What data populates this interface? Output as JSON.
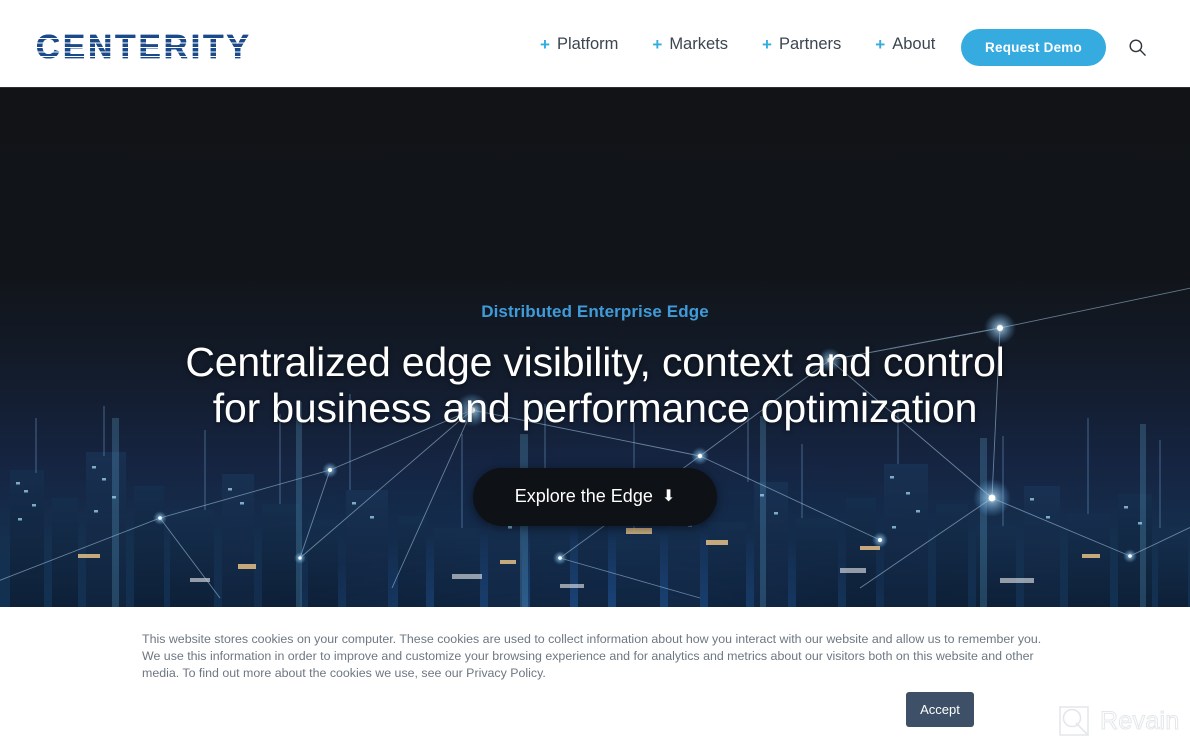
{
  "header": {
    "logo_text": "CENTERITY",
    "nav_items": [
      {
        "plus": "+",
        "label": "Platform"
      },
      {
        "plus": "+",
        "label": "Markets"
      },
      {
        "plus": "+",
        "label": "Partners"
      },
      {
        "plus": "+",
        "label": "About"
      }
    ],
    "demo_button": "Request Demo",
    "search_icon": "search-icon",
    "accent_color": "#35abe0",
    "logo_color": "#1f4e8c"
  },
  "hero": {
    "eyebrow": "Distributed Enterprise Edge",
    "headline_line1": "Centralized edge visibility, context and control",
    "headline_line2": "for business and performance optimization",
    "cta_label": "Explore the Edge",
    "cta_arrow": "⬇",
    "eyebrow_color": "#3f9bd9",
    "cta_background": "#0e1116"
  },
  "cookie_banner": {
    "text": "This website stores cookies on your computer. These cookies are used to collect information about how you interact with our website and allow us to remember you. We use this information in order to improve and customize your browsing experience and for analytics and metrics about our visitors both on this website and other media. To find out more about the cookies we use, see our Privacy Policy.",
    "accept_label": "Accept",
    "accept_color": "#3e5068"
  },
  "watermark": {
    "label": "Revain",
    "icon": "revain-logo-icon"
  }
}
